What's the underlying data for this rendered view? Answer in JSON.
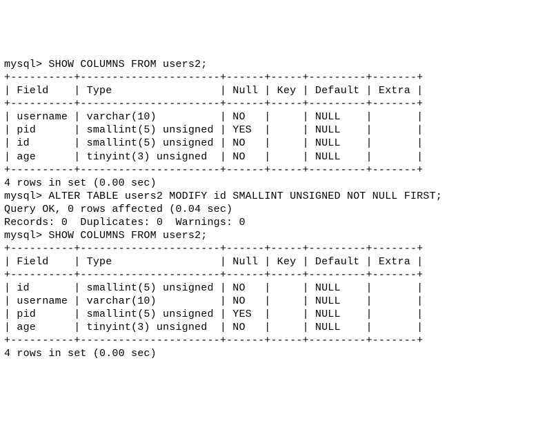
{
  "prompt": "mysql>",
  "commands": {
    "show1": "SHOW COLUMNS FROM users2;",
    "alter": "ALTER TABLE users2 MODIFY id SMALLINT UNSIGNED NOT NULL FIRST;",
    "show2": "SHOW COLUMNS FROM users2;"
  },
  "alter_response": {
    "line1": "Query OK, 0 rows affected (0.04 sec)",
    "line2": "Records: 0  Duplicates: 0  Warnings: 0"
  },
  "table_header": {
    "Field": "Field",
    "Type": "Type",
    "Null": "Null",
    "Key": "Key",
    "Default": "Default",
    "Extra": "Extra"
  },
  "table1": {
    "rows": [
      {
        "Field": "username",
        "Type": "varchar(10)",
        "Null": "NO",
        "Key": "",
        "Default": "NULL",
        "Extra": ""
      },
      {
        "Field": "pid",
        "Type": "smallint(5) unsigned",
        "Null": "YES",
        "Key": "",
        "Default": "NULL",
        "Extra": ""
      },
      {
        "Field": "id",
        "Type": "smallint(5) unsigned",
        "Null": "NO",
        "Key": "",
        "Default": "NULL",
        "Extra": ""
      },
      {
        "Field": "age",
        "Type": "tinyint(3) unsigned",
        "Null": "NO",
        "Key": "",
        "Default": "NULL",
        "Extra": ""
      }
    ],
    "footer": "4 rows in set (0.00 sec)"
  },
  "table2": {
    "rows": [
      {
        "Field": "id",
        "Type": "smallint(5) unsigned",
        "Null": "NO",
        "Key": "",
        "Default": "NULL",
        "Extra": ""
      },
      {
        "Field": "username",
        "Type": "varchar(10)",
        "Null": "NO",
        "Key": "",
        "Default": "NULL",
        "Extra": ""
      },
      {
        "Field": "pid",
        "Type": "smallint(5) unsigned",
        "Null": "YES",
        "Key": "",
        "Default": "NULL",
        "Extra": ""
      },
      {
        "Field": "age",
        "Type": "tinyint(3) unsigned",
        "Null": "NO",
        "Key": "",
        "Default": "NULL",
        "Extra": ""
      }
    ],
    "footer": "4 rows in set (0.00 sec)"
  },
  "widths": {
    "Field": 10,
    "Type": 22,
    "Null": 6,
    "Key": 5,
    "Default": 9,
    "Extra": 7
  },
  "chart_data": {
    "type": "table",
    "tables": [
      {
        "title": "SHOW COLUMNS FROM users2 (before ALTER)",
        "columns": [
          "Field",
          "Type",
          "Null",
          "Key",
          "Default",
          "Extra"
        ],
        "rows": [
          [
            "username",
            "varchar(10)",
            "NO",
            "",
            "NULL",
            ""
          ],
          [
            "pid",
            "smallint(5) unsigned",
            "YES",
            "",
            "NULL",
            ""
          ],
          [
            "id",
            "smallint(5) unsigned",
            "NO",
            "",
            "NULL",
            ""
          ],
          [
            "age",
            "tinyint(3) unsigned",
            "NO",
            "",
            "NULL",
            ""
          ]
        ]
      },
      {
        "title": "SHOW COLUMNS FROM users2 (after ALTER ... FIRST)",
        "columns": [
          "Field",
          "Type",
          "Null",
          "Key",
          "Default",
          "Extra"
        ],
        "rows": [
          [
            "id",
            "smallint(5) unsigned",
            "NO",
            "",
            "NULL",
            ""
          ],
          [
            "username",
            "varchar(10)",
            "NO",
            "",
            "NULL",
            ""
          ],
          [
            "pid",
            "smallint(5) unsigned",
            "YES",
            "",
            "NULL",
            ""
          ],
          [
            "age",
            "tinyint(3) unsigned",
            "NO",
            "",
            "NULL",
            ""
          ]
        ]
      }
    ]
  }
}
